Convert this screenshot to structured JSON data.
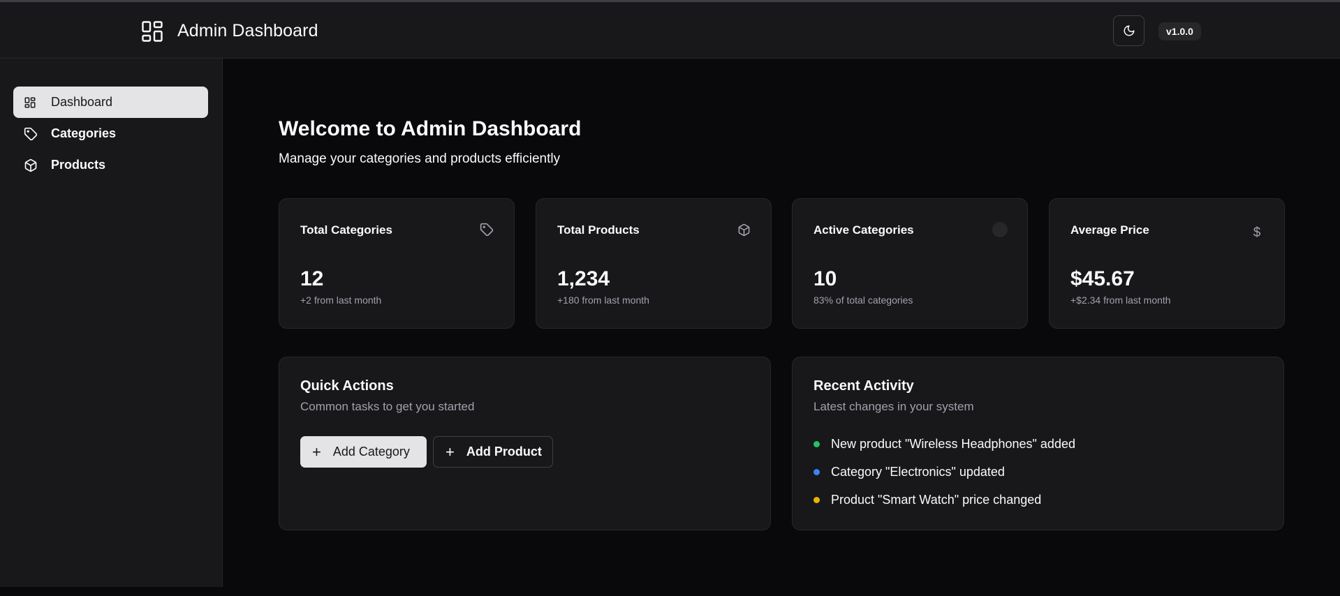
{
  "header": {
    "title": "Admin Dashboard",
    "version": "v1.0.0",
    "icons": {
      "logo": "layout-dashboard-icon",
      "theme": "moon-icon"
    }
  },
  "sidebar": {
    "items": [
      {
        "label": "Dashboard",
        "icon": "layout-dashboard-icon",
        "active": true
      },
      {
        "label": "Categories",
        "icon": "tag-icon",
        "active": false
      },
      {
        "label": "Products",
        "icon": "package-icon",
        "active": false
      }
    ]
  },
  "main": {
    "title": "Welcome to Admin Dashboard",
    "subtitle": "Manage your categories and products efficiently",
    "stats": [
      {
        "title": "Total Categories",
        "value": "12",
        "delta": "+2 from last month",
        "icon": "tag-icon"
      },
      {
        "title": "Total Products",
        "value": "1,234",
        "delta": "+180 from last month",
        "icon": "package-icon"
      },
      {
        "title": "Active Categories",
        "value": "10",
        "delta": "83% of total categories",
        "icon": "status-dot-icon"
      },
      {
        "title": "Average Price",
        "value": "$45.67",
        "delta": "+$2.34 from last month",
        "icon": "dollar-icon"
      }
    ],
    "quick_actions": {
      "title": "Quick Actions",
      "description": "Common tasks to get you started",
      "add_category": "Add Category",
      "add_product": "Add Product"
    },
    "recent_activity": {
      "title": "Recent Activity",
      "description": "Latest changes in your system",
      "items": [
        {
          "text": "New product \"Wireless Headphones\" added",
          "color": "#22c55e"
        },
        {
          "text": "Category \"Electronics\" updated",
          "color": "#3b82f6"
        },
        {
          "text": "Product \"Smart Watch\" price changed",
          "color": "#eab308"
        }
      ]
    }
  },
  "colors": {
    "background": "#09090b",
    "surface": "#18181b",
    "border": "#27272a",
    "muted": "#a1a1aa",
    "accent": "#e4e4e7"
  }
}
